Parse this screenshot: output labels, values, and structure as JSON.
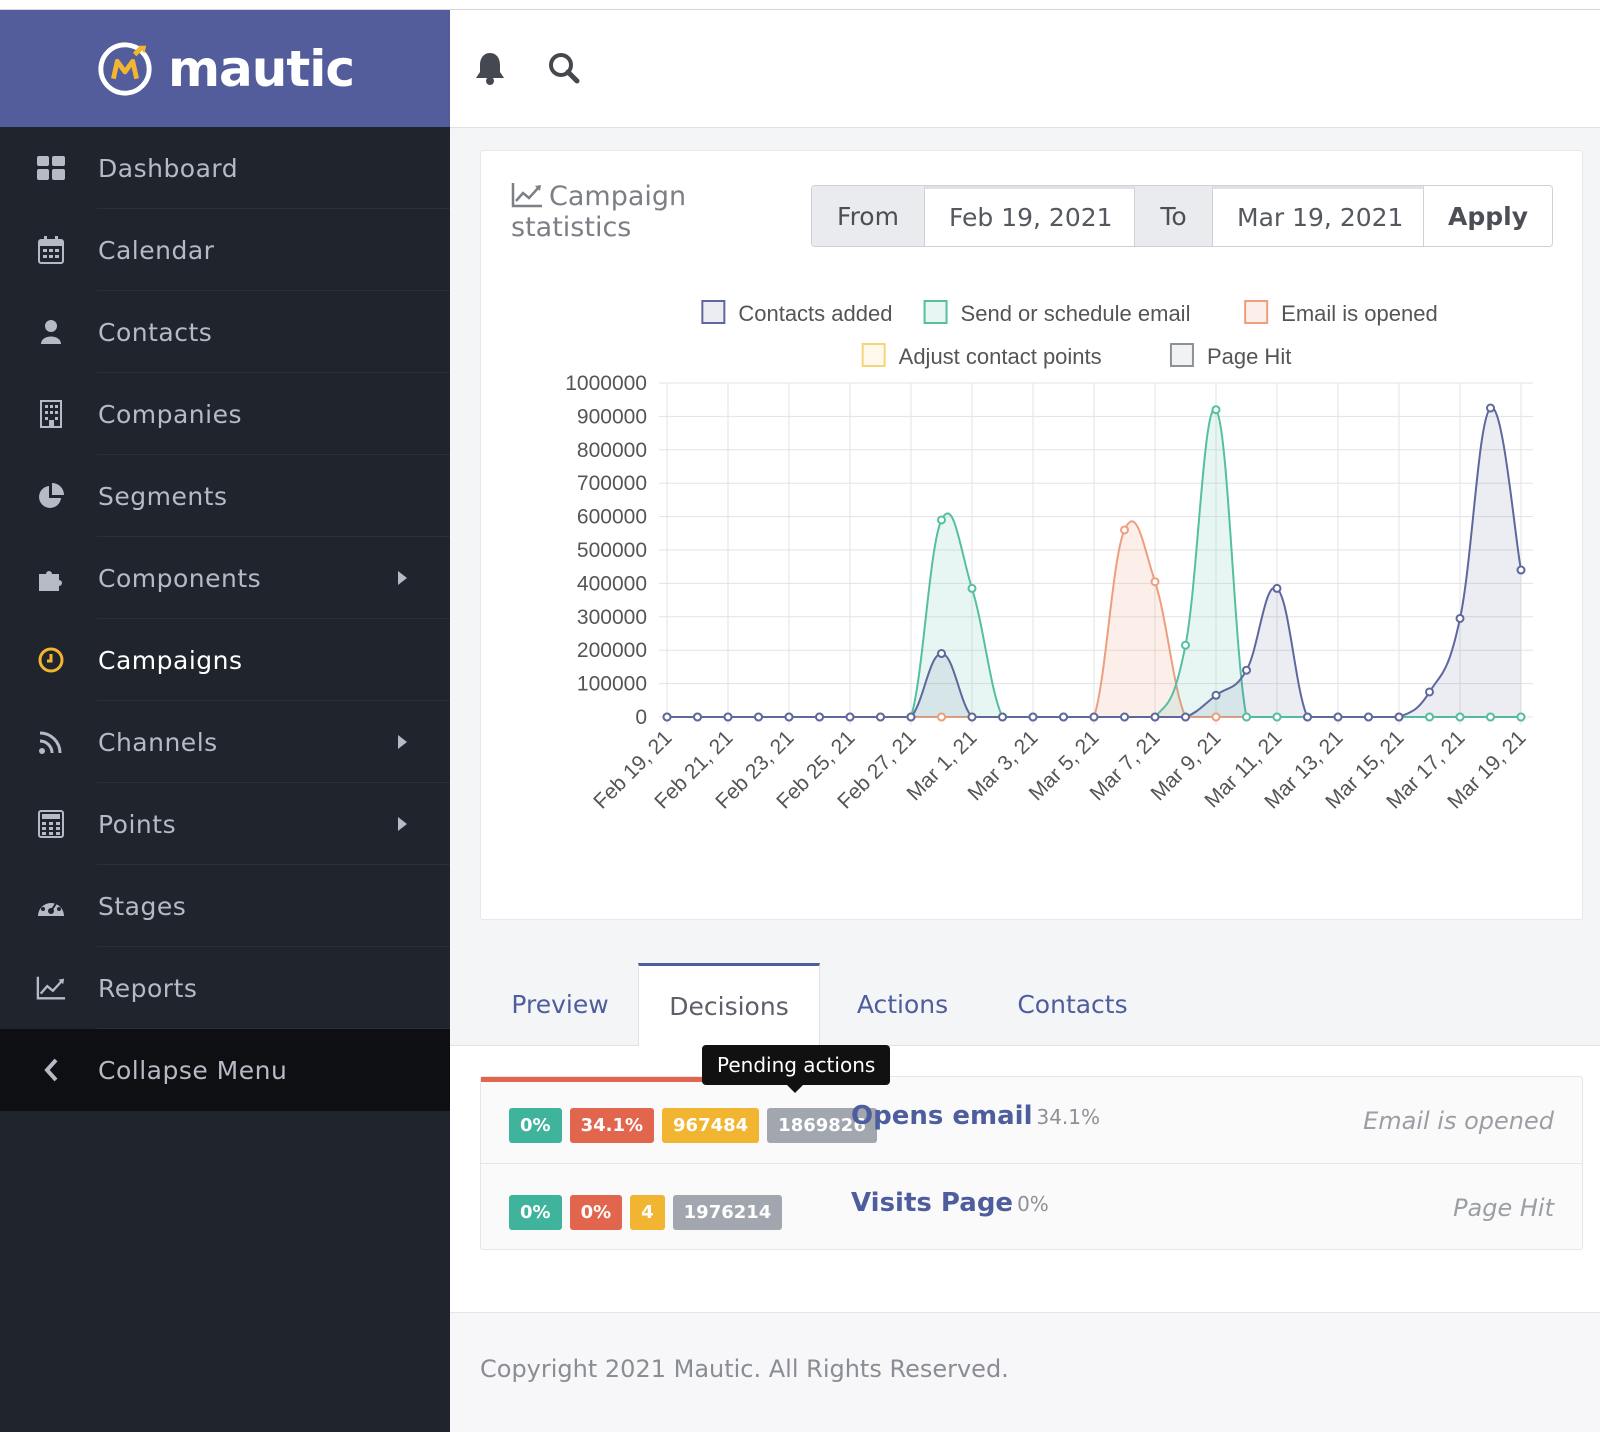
{
  "brand": {
    "name": "mautic"
  },
  "sidebar": {
    "items": [
      {
        "label": "Dashboard",
        "icon": "dashboard-icon",
        "has_submenu": false
      },
      {
        "label": "Calendar",
        "icon": "calendar-icon",
        "has_submenu": false
      },
      {
        "label": "Contacts",
        "icon": "user-icon",
        "has_submenu": false
      },
      {
        "label": "Companies",
        "icon": "building-icon",
        "has_submenu": false
      },
      {
        "label": "Segments",
        "icon": "pie-chart-icon",
        "has_submenu": false
      },
      {
        "label": "Components",
        "icon": "puzzle-icon",
        "has_submenu": true
      },
      {
        "label": "Campaigns",
        "icon": "clock-icon",
        "has_submenu": false,
        "active": true
      },
      {
        "label": "Channels",
        "icon": "rss-icon",
        "has_submenu": true
      },
      {
        "label": "Points",
        "icon": "calculator-icon",
        "has_submenu": true
      },
      {
        "label": "Stages",
        "icon": "tachometer-icon",
        "has_submenu": false
      },
      {
        "label": "Reports",
        "icon": "line-chart-icon",
        "has_submenu": false
      }
    ],
    "collapse_label": "Collapse Menu"
  },
  "header": {
    "icons": [
      "bell-icon",
      "search-icon"
    ]
  },
  "stats": {
    "title": "Campaign statistics",
    "from_label": "From",
    "from_value": "Feb 19, 2021",
    "to_label": "To",
    "to_value": "Mar 19, 2021",
    "apply_label": "Apply"
  },
  "chart_data": {
    "type": "line",
    "ylim": [
      0,
      1000000
    ],
    "y_ticks": [
      0,
      100000,
      200000,
      300000,
      400000,
      500000,
      600000,
      700000,
      800000,
      900000,
      1000000
    ],
    "x": [
      "Feb 19, 21",
      "Feb 20, 21",
      "Feb 21, 21",
      "Feb 22, 21",
      "Feb 23, 21",
      "Feb 24, 21",
      "Feb 25, 21",
      "Feb 26, 21",
      "Feb 27, 21",
      "Feb 28, 21",
      "Mar 1, 21",
      "Mar 2, 21",
      "Mar 3, 21",
      "Mar 4, 21",
      "Mar 5, 21",
      "Mar 6, 21",
      "Mar 7, 21",
      "Mar 8, 21",
      "Mar 9, 21",
      "Mar 10, 21",
      "Mar 11, 21",
      "Mar 12, 21",
      "Mar 13, 21",
      "Mar 14, 21",
      "Mar 15, 21",
      "Mar 16, 21",
      "Mar 17, 21",
      "Mar 18, 21",
      "Mar 19, 21"
    ],
    "x_tick_labels": [
      "Feb 19, 21",
      "Feb 21, 21",
      "Feb 23, 21",
      "Feb 25, 21",
      "Feb 27, 21",
      "Mar 1, 21",
      "Mar 3, 21",
      "Mar 5, 21",
      "Mar 7, 21",
      "Mar 9, 21",
      "Mar 11, 21",
      "Mar 13, 21",
      "Mar 15, 21",
      "Mar 17, 21",
      "Mar 19, 21"
    ],
    "legend_placement": "top",
    "grid": true,
    "series": [
      {
        "name": "Contacts added",
        "color": "#5e679e",
        "fill": "rgba(94,103,158,0.12)",
        "values": [
          0,
          0,
          0,
          0,
          0,
          0,
          0,
          0,
          0,
          190000,
          0,
          0,
          0,
          0,
          0,
          0,
          0,
          0,
          65000,
          140000,
          385000,
          0,
          0,
          0,
          0,
          75000,
          295000,
          925000,
          440000
        ]
      },
      {
        "name": "Send or schedule email",
        "color": "#54bfa1",
        "fill": "rgba(84,191,161,0.14)",
        "values": [
          0,
          0,
          0,
          0,
          0,
          0,
          0,
          0,
          0,
          590000,
          385000,
          0,
          0,
          0,
          0,
          0,
          0,
          215000,
          920000,
          0,
          0,
          0,
          0,
          0,
          0,
          0,
          0,
          0,
          0
        ]
      },
      {
        "name": "Email is opened",
        "color": "#ee9e7f",
        "fill": "rgba(238,158,127,0.16)",
        "values": [
          0,
          0,
          0,
          0,
          0,
          0,
          0,
          0,
          0,
          0,
          0,
          0,
          0,
          0,
          0,
          560000,
          405000,
          0,
          0,
          0,
          0,
          0,
          0,
          0,
          0,
          0,
          0,
          0,
          0
        ]
      },
      {
        "name": "Adjust contact points",
        "color": "#f7d47a",
        "fill": "rgba(247,212,122,0.15)",
        "values": [
          0,
          0,
          0,
          0,
          0,
          0,
          0,
          0,
          0,
          0,
          0,
          0,
          0,
          0,
          0,
          0,
          0,
          0,
          0,
          0,
          0,
          0,
          0,
          0,
          0,
          0,
          0,
          0,
          0
        ]
      },
      {
        "name": "Page Hit",
        "color": "#8e9098",
        "fill": "rgba(142,144,152,0.12)",
        "values": [
          0,
          0,
          0,
          0,
          0,
          0,
          0,
          0,
          0,
          0,
          0,
          0,
          0,
          0,
          0,
          0,
          0,
          0,
          0,
          0,
          0,
          0,
          0,
          0,
          0,
          0,
          0,
          0,
          0
        ]
      }
    ]
  },
  "tabs": [
    {
      "label": "Preview",
      "active": false
    },
    {
      "label": "Decisions",
      "active": true
    },
    {
      "label": "Actions",
      "active": false
    },
    {
      "label": "Contacts",
      "active": false
    }
  ],
  "tooltip": {
    "text": "Pending actions"
  },
  "decisions": [
    {
      "badges": [
        "0%",
        "34.1%",
        "967484",
        "1869826"
      ],
      "title": "Opens email",
      "percent": "34.1%",
      "type": "Email is opened"
    },
    {
      "badges": [
        "0%",
        "0%",
        "4",
        "1976214"
      ],
      "title": "Visits Page",
      "percent": "0%",
      "type": "Page Hit"
    }
  ],
  "footer": {
    "text": "Copyright 2021 Mautic. All Rights Reserved."
  }
}
